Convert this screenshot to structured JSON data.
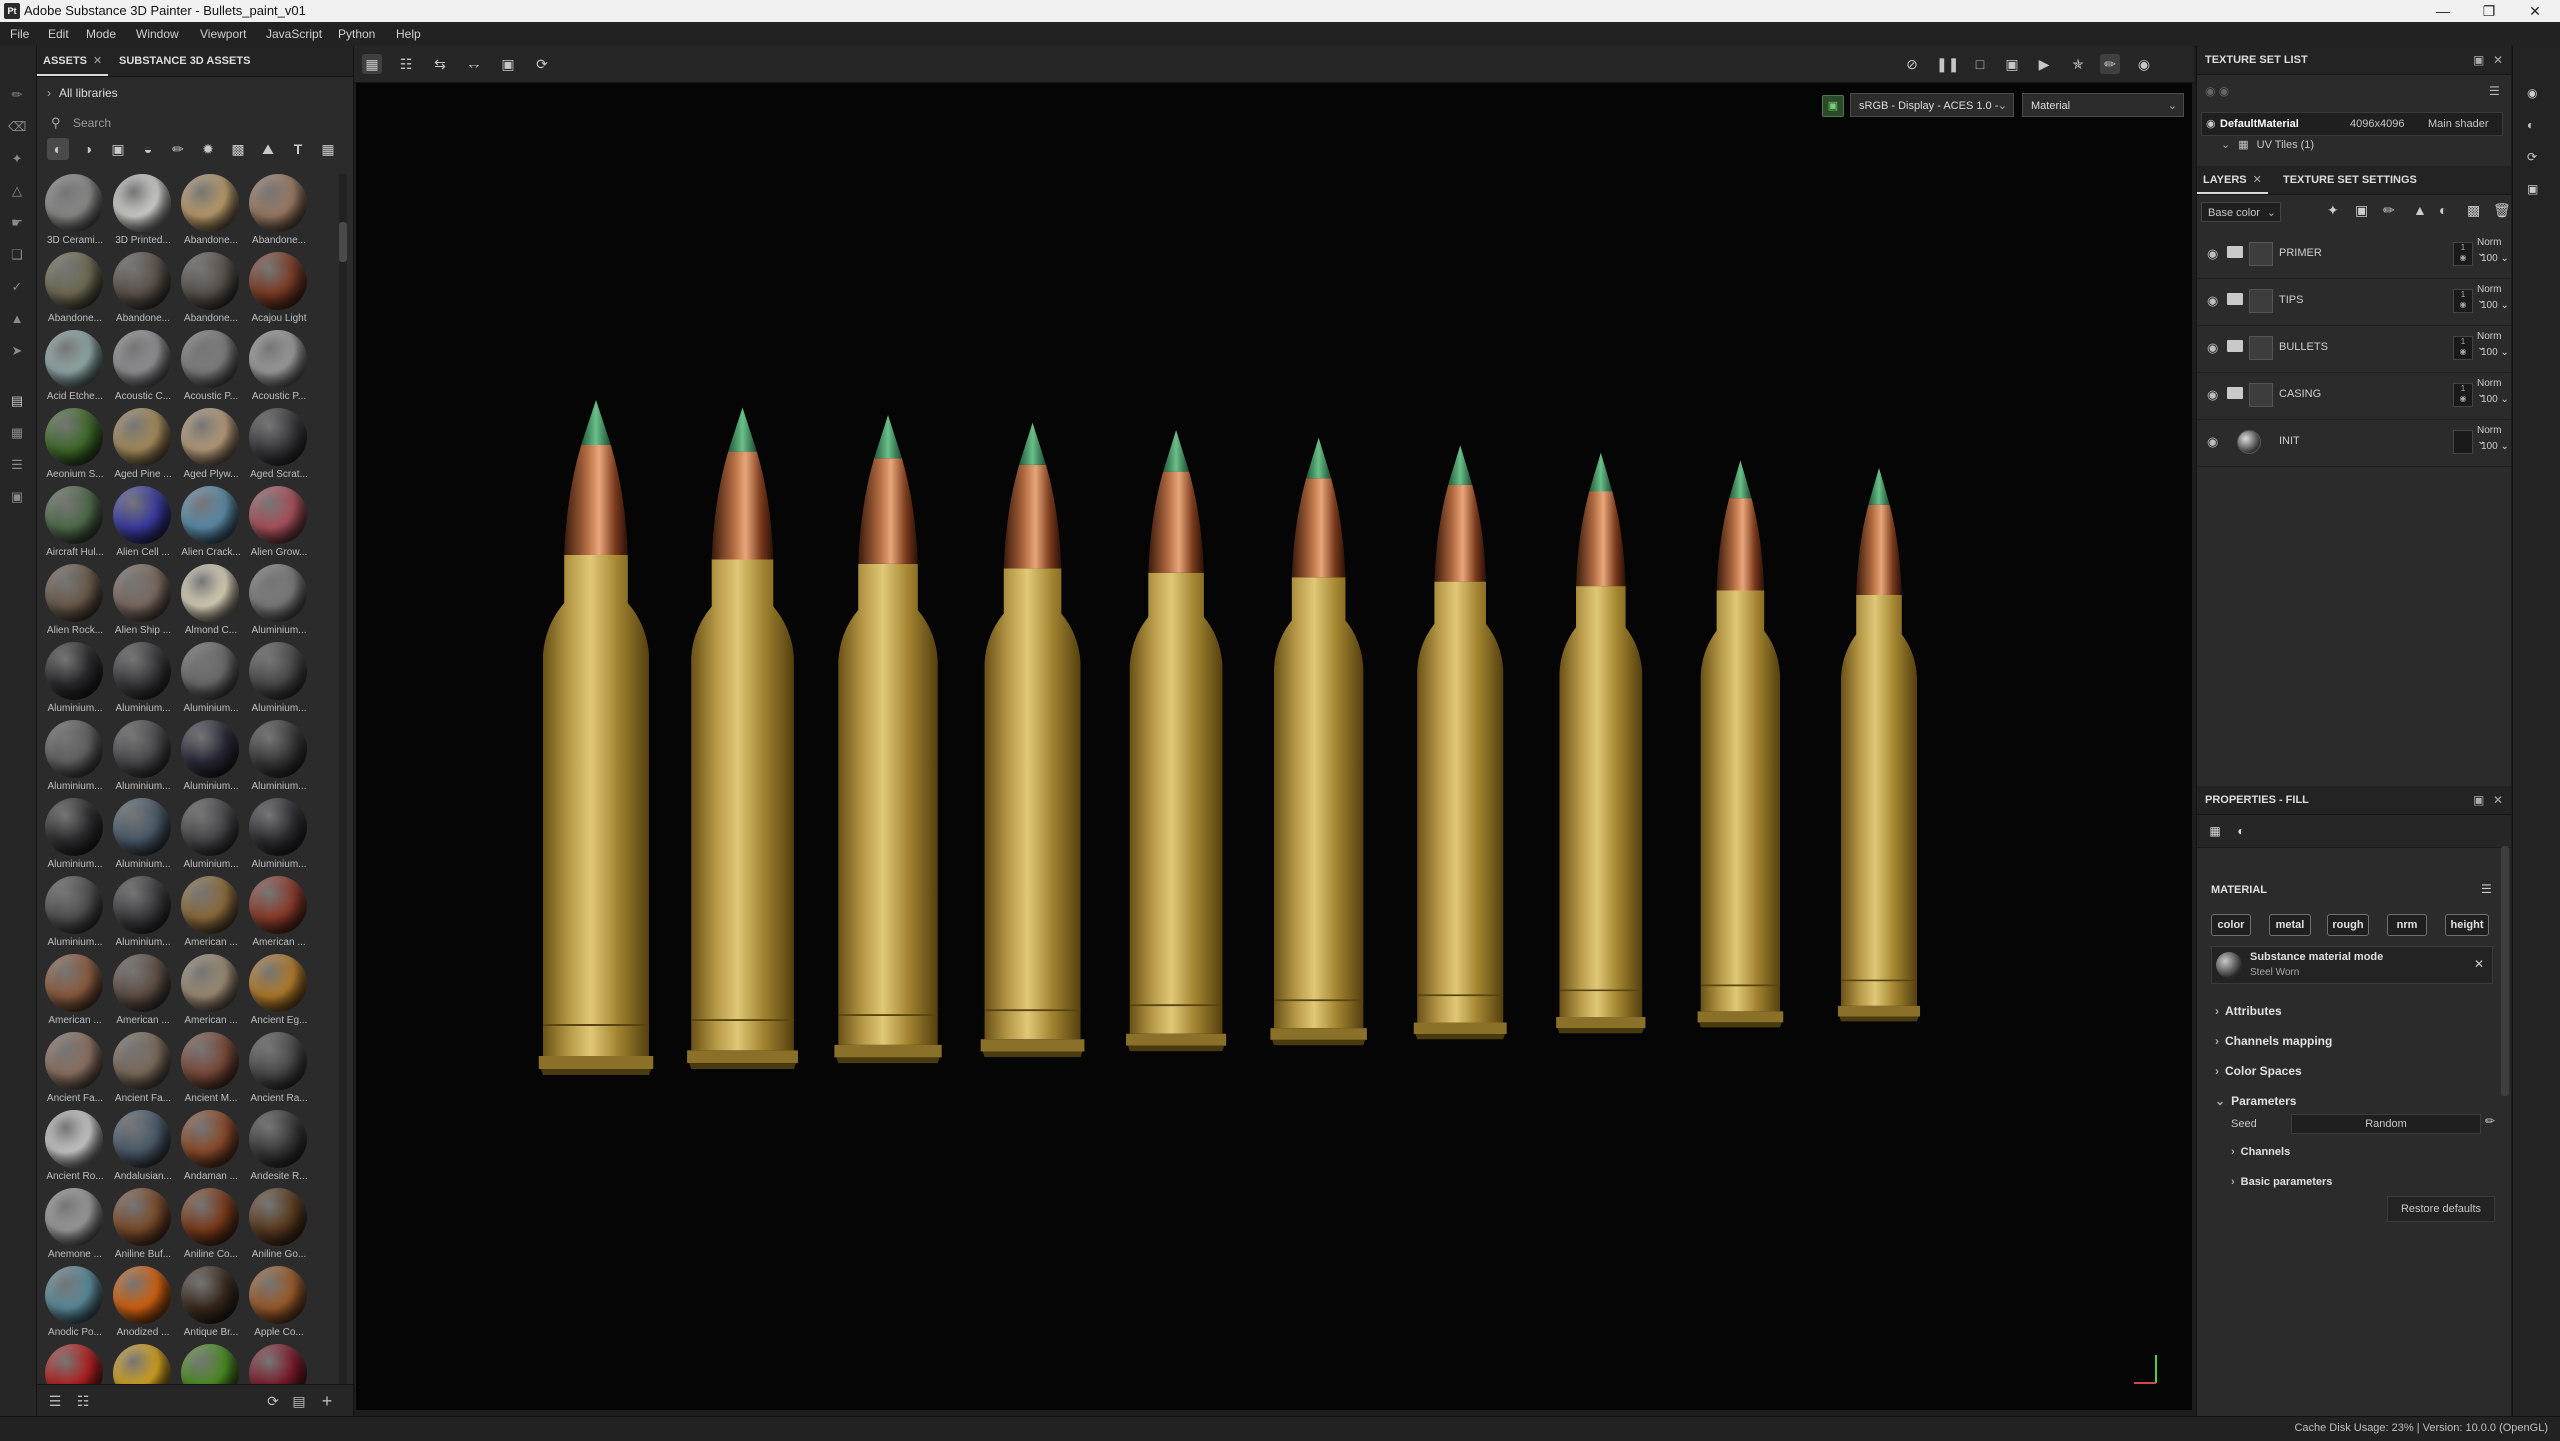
{
  "window": {
    "title": "Adobe Substance 3D Painter - Bullets_paint_v01",
    "controls": [
      "minimize",
      "maximize",
      "close"
    ]
  },
  "menu": [
    "File",
    "Edit",
    "Mode",
    "Window",
    "Viewport",
    "JavaScript",
    "Python",
    "Help"
  ],
  "tools": [
    "paint-brush-icon",
    "eraser-icon",
    "projection-icon",
    "geometry-mask-icon",
    "smudge-icon",
    "clone-icon",
    "picker-icon",
    "polygon-fill-icon",
    "selection-icon",
    "material-picker-icon",
    "baking-icon",
    "export-icon",
    "report-icon"
  ],
  "assets": {
    "tabs": [
      {
        "label": "ASSETS",
        "active": true
      },
      {
        "label": "SUBSTANCE 3D ASSETS",
        "active": false
      }
    ],
    "library": "All libraries",
    "search_placeholder": "Search",
    "filters": [
      "material-filter-icon",
      "smart-material-filter-icon",
      "mask-filter-icon",
      "smart-mask-filter-icon",
      "brush-filter-icon",
      "particle-filter-icon",
      "alpha-filter-icon",
      "environment-filter-icon",
      "text-filter-icon",
      "grid-view-icon"
    ],
    "items": [
      {
        "label": "3D Cerami...",
        "color": "#8a8a88"
      },
      {
        "label": "3D Printed...",
        "color": "#cfcfcb"
      },
      {
        "label": "Abandone...",
        "color": "#b89a6a"
      },
      {
        "label": "Abandone...",
        "color": "#9a7a62"
      },
      {
        "label": "Abandone...",
        "color": "#6e6a52"
      },
      {
        "label": "Abandone...",
        "color": "#5a5048"
      },
      {
        "label": "Abandone...",
        "color": "#57514b"
      },
      {
        "label": "Acajou Light",
        "color": "#7a3a24"
      },
      {
        "label": "Acid Etche...",
        "color": "#90a8a8"
      },
      {
        "label": "Acoustic C...",
        "color": "#8f8f94"
      },
      {
        "label": "Acoustic P...",
        "color": "#7d7d7d"
      },
      {
        "label": "Acoustic P...",
        "color": "#9a9a9a"
      },
      {
        "label": "Aeonium S...",
        "color": "#3f6a2a"
      },
      {
        "label": "Aged Pine ...",
        "color": "#a48a5a"
      },
      {
        "label": "Aged Plyw...",
        "color": "#b59a78"
      },
      {
        "label": "Aged Scrat...",
        "color": "#3a3a3e"
      },
      {
        "label": "Aircraft Hul...",
        "color": "#4f6a4a"
      },
      {
        "label": "Alien Cell ...",
        "color": "#3a3aa0"
      },
      {
        "label": "Alien Crack...",
        "color": "#5a8aa8"
      },
      {
        "label": "Alien Grow...",
        "color": "#a8505a"
      },
      {
        "label": "Alien Rock...",
        "color": "#6a5a4a"
      },
      {
        "label": "Alien Ship ...",
        "color": "#7a6a60"
      },
      {
        "label": "Almond C...",
        "color": "#d8d0b8"
      },
      {
        "label": "Aluminium...",
        "color": "#7a7a7a"
      },
      {
        "label": "Aluminium...",
        "color": "#2a2a2e"
      },
      {
        "label": "Aluminium...",
        "color": "#3a3a3e"
      },
      {
        "label": "Aluminium...",
        "color": "#6a6a6a"
      },
      {
        "label": "Aluminium...",
        "color": "#4a4a4a"
      },
      {
        "label": "Aluminium...",
        "color": "#606060"
      },
      {
        "label": "Aluminium...",
        "color": "#4a4a4e"
      },
      {
        "label": "Aluminium...",
        "color": "#2a2a38"
      },
      {
        "label": "Aluminium...",
        "color": "#3a3a3a"
      },
      {
        "label": "Aluminium...",
        "color": "#2e2e30"
      },
      {
        "label": "Aluminium...",
        "color": "#4a5a6a"
      },
      {
        "label": "Aluminium...",
        "color": "#48484c"
      },
      {
        "label": "Aluminium...",
        "color": "#2e2e34"
      },
      {
        "label": "Aluminium...",
        "color": "#505050"
      },
      {
        "label": "Aluminium...",
        "color": "#3c3c40"
      },
      {
        "label": "American ...",
        "color": "#8a6a3a"
      },
      {
        "label": "American ...",
        "color": "#8a3a2a"
      },
      {
        "label": "American ...",
        "color": "#8a5a3e"
      },
      {
        "label": "American ...",
        "color": "#5e4e44"
      },
      {
        "label": "American ...",
        "color": "#9a8a72"
      },
      {
        "label": "Ancient Eg...",
        "color": "#b07a2a"
      },
      {
        "label": "Ancient Fa...",
        "color": "#8a7060"
      },
      {
        "label": "Ancient Fa...",
        "color": "#7a6a5a"
      },
      {
        "label": "Ancient M...",
        "color": "#7a4a3a"
      },
      {
        "label": "Ancient Ra...",
        "color": "#4a4a4a"
      },
      {
        "label": "Ancient Ro...",
        "color": "#c8c8c8"
      },
      {
        "label": "Andalusian...",
        "color": "#4a5a6a"
      },
      {
        "label": "Andaman ...",
        "color": "#8a4a2a"
      },
      {
        "label": "Andesite R...",
        "color": "#3a3a3a"
      },
      {
        "label": "Anemone ...",
        "color": "#9a9a9a"
      },
      {
        "label": "Aniline Buf...",
        "color": "#7a4a2a"
      },
      {
        "label": "Aniline Co...",
        "color": "#7a3a1a"
      },
      {
        "label": "Aniline Go...",
        "color": "#5a3a1e"
      },
      {
        "label": "Anodic Po...",
        "color": "#5a8a9a"
      },
      {
        "label": "Anodized ...",
        "color": "#d06010"
      },
      {
        "label": "Antique Br...",
        "color": "#3a2a1e"
      },
      {
        "label": "Apple Co...",
        "color": "#9a5a2a"
      },
      {
        "label": "",
        "color": "#b02020"
      },
      {
        "label": "",
        "color": "#d0a020"
      },
      {
        "label": "",
        "color": "#4a8a20"
      },
      {
        "label": "",
        "color": "#7a1a2a"
      }
    ]
  },
  "viewport": {
    "toolbar_left": [
      "2d-3d-view-icon",
      "grid-layout-icon",
      "symmetry-icon",
      "align-icon",
      "frame-icon",
      "history-icon"
    ],
    "toolbar_right": [
      "hide-icon",
      "pause-icon",
      "render-mode-icon",
      "camera-icon",
      "video-icon",
      "light-icon",
      "paint-mode-icon",
      "screenshot-icon"
    ],
    "color_dropdown": "sRGB - Display - ACES 1.0 -",
    "mode_dropdown": "Material",
    "bullets": [
      {
        "label": "bullet-1"
      },
      {
        "label": "bullet-2"
      },
      {
        "label": "bullet-3"
      },
      {
        "label": "bullet-4"
      },
      {
        "label": "bullet-5"
      },
      {
        "label": "bullet-6"
      },
      {
        "label": "bullet-7"
      },
      {
        "label": "bullet-8"
      },
      {
        "label": "bullet-9"
      },
      {
        "label": "bullet-10"
      }
    ]
  },
  "texture_set_list": {
    "title": "TEXTURE SET LIST",
    "row": {
      "name": "DefaultMaterial",
      "resolution": "4096x4096",
      "shader": "Main shader"
    },
    "uv": "UV Tiles (1)"
  },
  "layers": {
    "tabs": [
      {
        "label": "LAYERS",
        "active": true
      },
      {
        "label": "TEXTURE SET SETTINGS",
        "active": false
      }
    ],
    "channel": "Base color",
    "items": [
      {
        "name": "PRIMER",
        "blend": "Norm",
        "opacity": "100",
        "type": "folder"
      },
      {
        "name": "TIPS",
        "blend": "Norm",
        "opacity": "100",
        "type": "folder"
      },
      {
        "name": "BULLETS",
        "blend": "Norm",
        "opacity": "100",
        "type": "folder"
      },
      {
        "name": "CASING",
        "blend": "Norm",
        "opacity": "100",
        "type": "folder"
      },
      {
        "name": "INIT",
        "blend": "Norm",
        "opacity": "100",
        "type": "fill"
      }
    ]
  },
  "properties": {
    "title": "PROPERTIES - FILL",
    "material_header": "MATERIAL",
    "channels": [
      "color",
      "metal",
      "rough",
      "nrm",
      "height"
    ],
    "material_mode": {
      "title": "Substance material mode",
      "sub": "Steel Worn"
    },
    "sections": [
      "Attributes",
      "Channels mapping",
      "Color Spaces",
      "Parameters"
    ],
    "seed_label": "Seed",
    "seed_value": "Random",
    "subsections": [
      "Channels",
      "Basic parameters"
    ],
    "restore": "Restore defaults"
  },
  "status": {
    "text": "Cache Disk Usage:   23% | Version: 10.0.0 (OpenGL)"
  }
}
